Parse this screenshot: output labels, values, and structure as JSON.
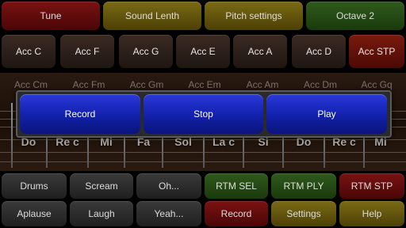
{
  "top_tabs": [
    "Tune",
    "Sound Lenth",
    "Pitch settings",
    "Octave 2"
  ],
  "acc_row1": [
    "Acc C",
    "Acc F",
    "Acc G",
    "Acc E",
    "Acc A",
    "Acc D",
    "Acc STP"
  ],
  "acc_row2": [
    "Acc Cm",
    "Acc Fm",
    "Acc Gm",
    "Acc Em",
    "Acc Am",
    "Acc Dm",
    "Acc Gq"
  ],
  "notes": [
    "Do",
    "Re c",
    "Mi",
    "Fa",
    "Sol",
    "La c",
    "Si",
    "Do",
    "Re c",
    "Mi"
  ],
  "dialog": {
    "record": "Record",
    "stop": "Stop",
    "play": "Play"
  },
  "bottom_row1": [
    "Drums",
    "Scream",
    "Oh...",
    "RTM SEL",
    "RTM PLY",
    "RTM STP"
  ],
  "bottom_row2": [
    "Aplause",
    "Laugh",
    "Yeah...",
    "Record",
    "Settings",
    "Help"
  ]
}
